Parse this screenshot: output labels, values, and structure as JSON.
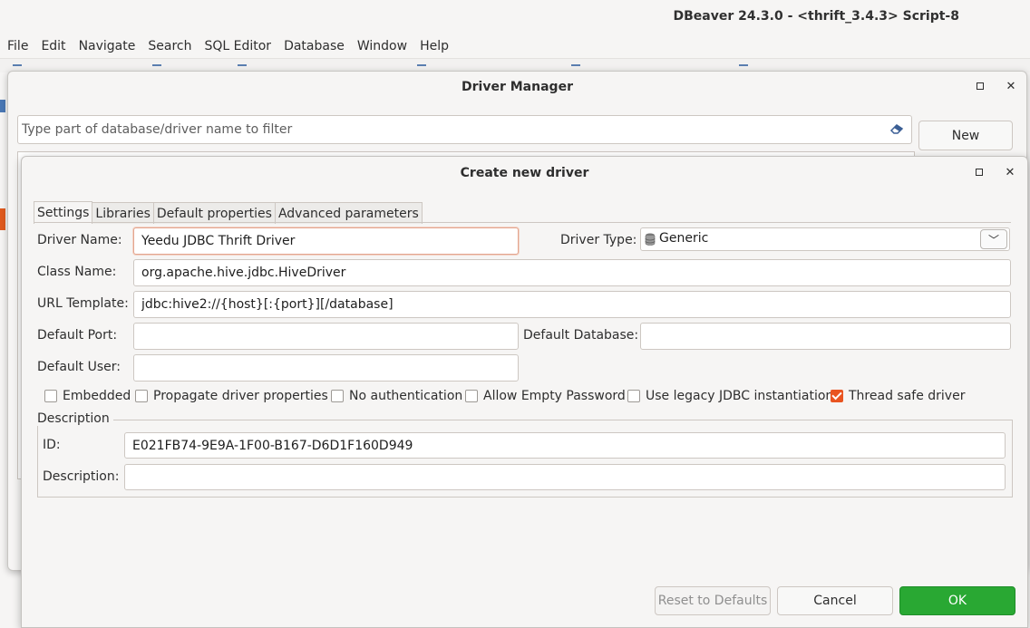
{
  "app": {
    "title": "DBeaver 24.3.0 - <thrift_3.4.3> Script-8"
  },
  "menu": [
    "File",
    "Edit",
    "Navigate",
    "Search",
    "SQL Editor",
    "Database",
    "Window",
    "Help"
  ],
  "driver_manager": {
    "title": "Driver Manager",
    "filter_placeholder": "Type part of database/driver name to filter",
    "new_label": "New"
  },
  "create_driver": {
    "title": "Create new driver",
    "tabs": [
      "Settings",
      "Libraries",
      "Default properties",
      "Advanced parameters"
    ],
    "labels": {
      "driver_name": "Driver Name:",
      "driver_type": "Driver Type:",
      "class_name": "Class Name:",
      "url_template": "URL Template:",
      "default_port": "Default Port:",
      "default_database": "Default Database:",
      "default_user": "Default User:",
      "description_group": "Description",
      "id": "ID:",
      "description": "Description:"
    },
    "values": {
      "driver_name": "Yeedu JDBC Thrift Driver",
      "driver_type": "Generic",
      "class_name": "org.apache.hive.jdbc.HiveDriver",
      "url_template": "jdbc:hive2://{host}[:{port}][/database]",
      "default_port": "",
      "default_database": "",
      "default_user": "",
      "id": "E021FB74-9E9A-1F00-B167-D6D1F160D949",
      "description": ""
    },
    "checkboxes": [
      {
        "label": "Embedded",
        "checked": false
      },
      {
        "label": "Propagate driver properties",
        "checked": false
      },
      {
        "label": "No authentication",
        "checked": false
      },
      {
        "label": "Allow Empty Password",
        "checked": false
      },
      {
        "label": "Use legacy JDBC instantiation",
        "checked": false
      },
      {
        "label": "Thread safe driver",
        "checked": true
      }
    ],
    "buttons": {
      "reset": "Reset to Defaults",
      "cancel": "Cancel",
      "ok": "OK"
    }
  },
  "colors": {
    "ok_button": "#29a833",
    "checkbox_checked": "#e95420",
    "accent_orange": "#e05a1e"
  }
}
